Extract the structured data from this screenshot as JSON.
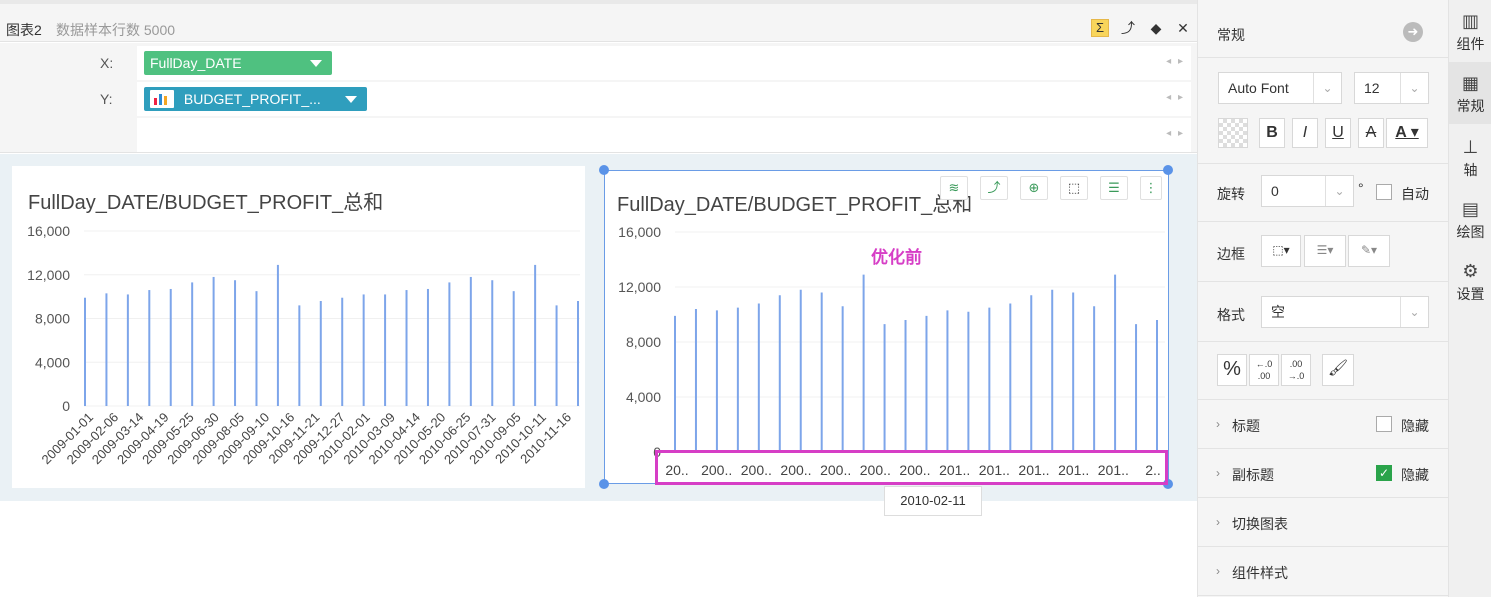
{
  "header": {
    "title": "图表2",
    "sample_text": "数据样本行数 5000",
    "tools": [
      "Σ",
      "⤴",
      "◆",
      "✕"
    ]
  },
  "binding": {
    "x_label": "X:",
    "y_label": "Y:",
    "x_field": "FullDay_DATE",
    "y_field": "BUDGET_PROFIT_...",
    "arrows": "◂ ▸"
  },
  "chart_data": [
    {
      "type": "bar",
      "title": "FullDay_DATE/BUDGET_PROFIT_总和",
      "ylim": [
        0,
        16000
      ],
      "yticks": [
        "16,000",
        "12,000",
        "8,000",
        "4,000",
        "0"
      ],
      "values": [
        9900,
        10300,
        10200,
        10600,
        10700,
        11300,
        11800,
        11500,
        10500,
        12900,
        9200,
        9600,
        9900,
        10200,
        10200,
        10600,
        10700,
        11300,
        11800,
        11500,
        10500,
        12900,
        9200,
        9600
      ],
      "xtick_labels": [
        "2009-01-01",
        "2009-02-06",
        "2009-03-14",
        "2009-04-19",
        "2009-05-25",
        "2009-06-30",
        "2009-08-05",
        "2009-09-10",
        "2009-10-16",
        "2009-11-21",
        "2009-12-27",
        "2010-02-01",
        "2010-03-09",
        "2010-04-14",
        "2010-05-20",
        "2010-06-25",
        "2010-07-31",
        "2010-09-05",
        "2010-10-11",
        "2010-11-16"
      ],
      "bar_color": "#7da5ea"
    },
    {
      "type": "bar",
      "title": "FullDay_DATE/BUDGET_PROFIT_总和",
      "ylim": [
        0,
        16000
      ],
      "yticks": [
        "16,000",
        "12,000",
        "8,000",
        "4,000",
        "0"
      ],
      "values": [
        9900,
        10400,
        10300,
        10500,
        10800,
        11400,
        11800,
        11600,
        10600,
        12900,
        9300,
        9600,
        9900,
        10300,
        10200,
        10500,
        10800,
        11400,
        11800,
        11600,
        10600,
        12900,
        9300,
        9600
      ],
      "xtick_labels": [
        "20..",
        "200..",
        "200..",
        "200..",
        "200..",
        "200..",
        "200..",
        "201..",
        "201..",
        "201..",
        "201..",
        "201..",
        "2.."
      ],
      "annotation": "优化前",
      "tooltip": "2010-02-11",
      "bar_color": "#7da5ea"
    }
  ],
  "chart_tools": [
    "db-icon",
    "swap-icon",
    "zoom-icon",
    "select-icon",
    "list-icon",
    "more-icon"
  ],
  "panel": {
    "section_title": "常规",
    "font_name": "Auto Font",
    "font_size": "12",
    "format_buttons": [
      "B",
      "I",
      "U",
      "A"
    ],
    "rotate_label": "旋转",
    "rotate_value": "0",
    "rotate_unit": "°",
    "auto_label": "自动",
    "border_label": "边框",
    "format_label": "格式",
    "format_value": "空",
    "numfmt_percent": "%",
    "rows": [
      {
        "label": "标题",
        "hide": "隐藏",
        "checked": false
      },
      {
        "label": "副标题",
        "hide": "隐藏",
        "checked": true
      },
      {
        "label": "切换图表"
      },
      {
        "label": "组件样式"
      }
    ]
  },
  "sidetabs": [
    {
      "label": "组件",
      "icon": "bar-chart-icon"
    },
    {
      "label": "常规",
      "icon": "grid-icon"
    },
    {
      "label": "轴",
      "icon": "axis-icon"
    },
    {
      "label": "绘图",
      "icon": "draw-icon"
    },
    {
      "label": "设置",
      "icon": "gear-icon"
    }
  ]
}
